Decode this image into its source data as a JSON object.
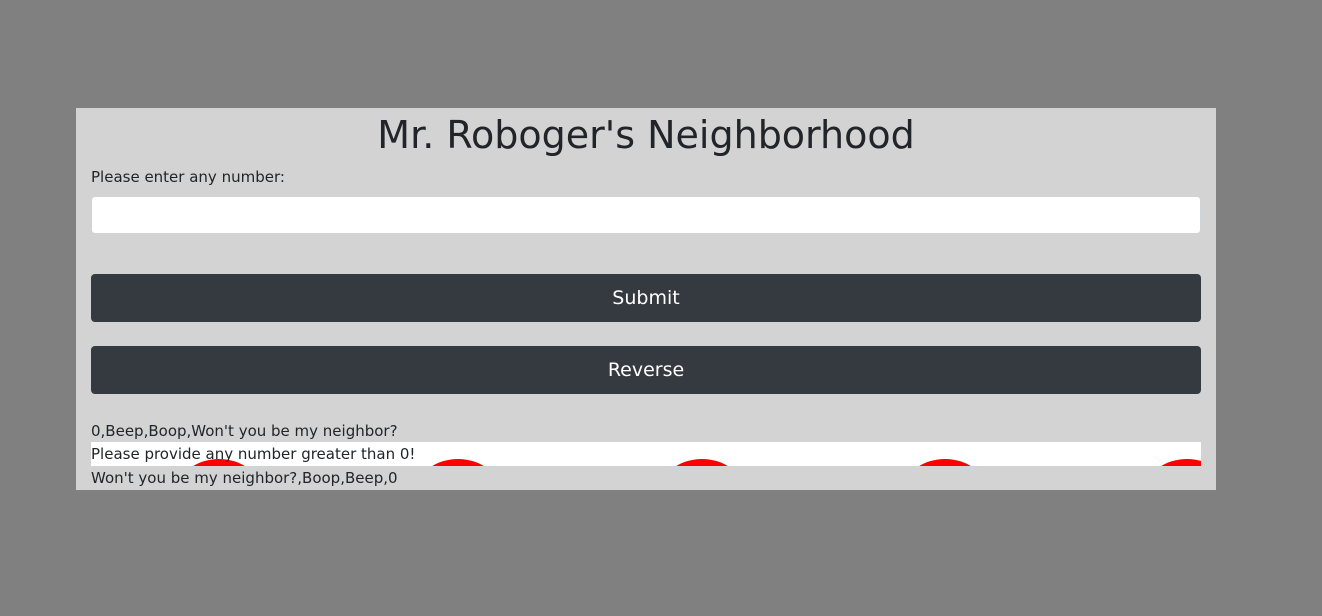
{
  "page": {
    "title": "Mr. Roboger's Neighborhood"
  },
  "form": {
    "input_label": "Please enter any number:",
    "input_value": "",
    "input_placeholder": "",
    "submit_label": "Submit",
    "reverse_label": "Reverse"
  },
  "results": {
    "forward": "0,Beep,Boop,Won't you be my neighbor?",
    "error": "Please provide any number greater than 0!",
    "reversed": "Won't you be my neighbor?,Boop,Beep,0"
  },
  "colors": {
    "background": "#808080",
    "panel": "#d3d3d3",
    "button": "#343a40",
    "decoration": "#ff0000"
  }
}
